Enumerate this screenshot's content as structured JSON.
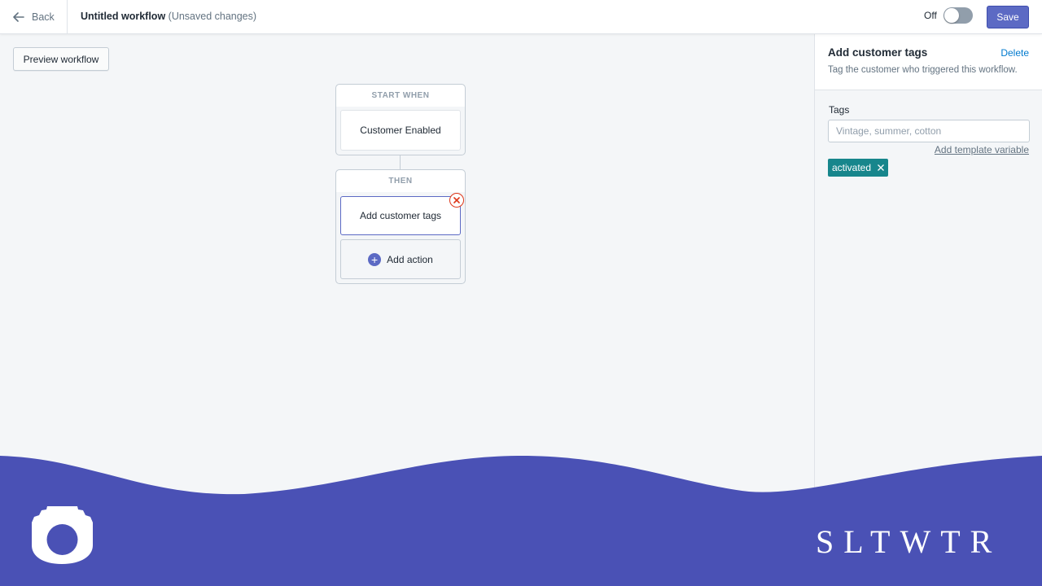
{
  "topbar": {
    "back_label": "Back",
    "title": "Untitled workflow",
    "status": "(Unsaved changes)",
    "toggle_label": "Off",
    "toggle_on": false,
    "save_label": "Save"
  },
  "canvas": {
    "preview_label": "Preview workflow",
    "start_block": {
      "header": "START WHEN",
      "trigger": "Customer Enabled"
    },
    "then_block": {
      "header": "THEN",
      "action": "Add customer tags",
      "add_action_label": "Add action"
    }
  },
  "panel": {
    "title": "Add customer tags",
    "delete_label": "Delete",
    "description": "Tag the customer who triggered this workflow.",
    "tags_label": "Tags",
    "tags_placeholder": "Vintage, summer, cotton",
    "tags_value": "",
    "template_link": "Add template variable",
    "tags": [
      "activated"
    ]
  },
  "footer": {
    "brand": "SLTWTR",
    "brand_color": "#4a51b5"
  },
  "colors": {
    "accent": "#5c6ac4",
    "tag": "#17868c",
    "danger": "#de3618",
    "link": "#007ace"
  }
}
